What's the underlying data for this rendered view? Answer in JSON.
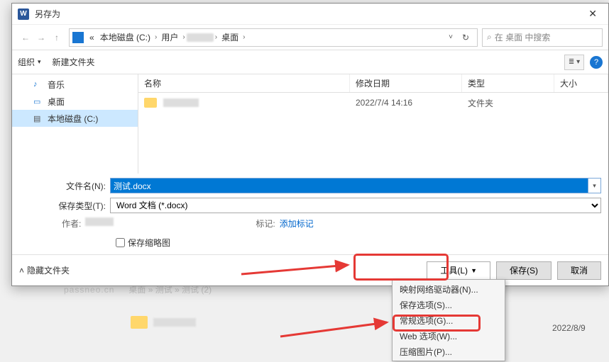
{
  "titlebar": {
    "title": "另存为"
  },
  "breadcrumb": {
    "drive": "本地磁盘 (C:)",
    "users": "用户",
    "desktop": "桌面"
  },
  "search": {
    "placeholder": "在 桌面 中搜索"
  },
  "toolbar": {
    "organize": "组织",
    "newfolder": "新建文件夹"
  },
  "sidebar": {
    "music": "音乐",
    "desktop": "桌面",
    "cdrive": "本地磁盘 (C:)"
  },
  "listheader": {
    "name": "名称",
    "date": "修改日期",
    "type": "类型",
    "size": "大小"
  },
  "filerow": {
    "date": "2022/7/4 14:16",
    "type": "文件夹"
  },
  "form": {
    "filename_label": "文件名(N):",
    "filename_value": "测试.docx",
    "savetype_label": "保存类型(T):",
    "savetype_value": "Word 文档 (*.docx)",
    "author_label": "作者:",
    "tags_label": "标记:",
    "tags_value": "添加标记",
    "thumbnail_label": "保存缩略图"
  },
  "footer": {
    "hide": "隐藏文件夹",
    "tools": "工具(L)",
    "save": "保存(S)",
    "cancel": "取消"
  },
  "dropdown": {
    "map_drive": "映射网络驱动器(N)...",
    "save_opts": "保存选项(S)...",
    "general_opts": "常规选项(G)...",
    "web_opts": "Web 选项(W)...",
    "compress": "压缩图片(P)..."
  },
  "behind": {
    "watermark": "passneo.cn",
    "crumb": "桌面 » 测试 » 测试 (2)",
    "date": "2022/8/9"
  }
}
